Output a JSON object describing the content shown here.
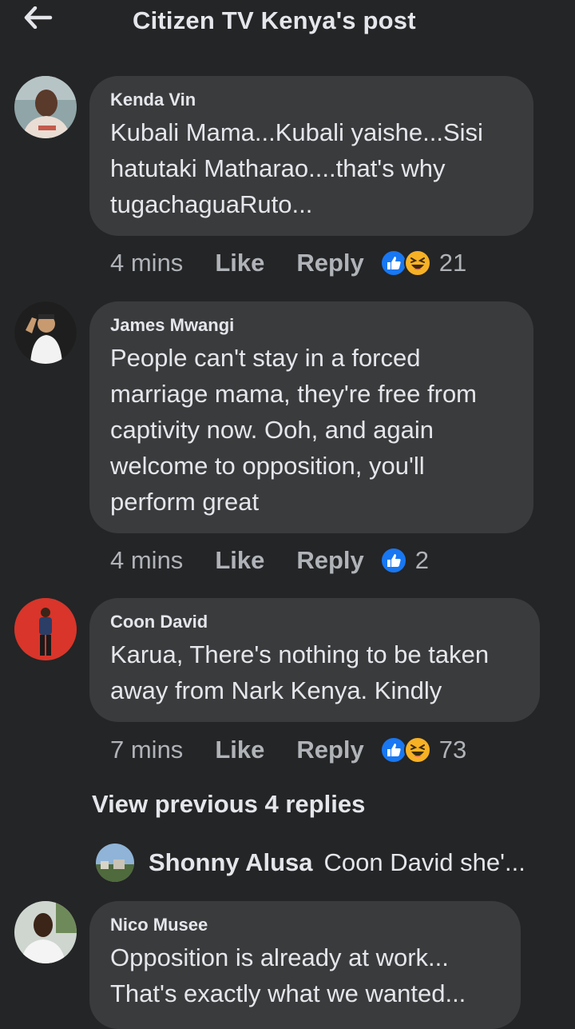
{
  "header": {
    "back_icon": "arrow-left-icon",
    "title": "Citizen TV Kenya's post"
  },
  "comments": [
    {
      "name": "Kenda Vin",
      "lines": [
        "Kubali Mama...Kubali yaishe...Sisi",
        "hatutaki Matharao....that's why",
        "tugachaguaRuto..."
      ],
      "time": "4 mins",
      "like": "Like",
      "reply": "Reply",
      "reactions": [
        "like-reaction-icon",
        "haha-reaction-icon"
      ],
      "count": "21"
    },
    {
      "name": "James Mwangi",
      "lines": [
        "People can't stay in a forced",
        "marriage mama, they're free from",
        "captivity now. Ooh, and again",
        "welcome to opposition, you'll",
        "perform great"
      ],
      "time": "4 mins",
      "like": "Like",
      "reply": "Reply",
      "reactions": [
        "like-reaction-icon"
      ],
      "count": "2"
    },
    {
      "name": "Coon David",
      "lines": [
        "Karua, There's nothing to be taken",
        "away from Nark Kenya. Kindly"
      ],
      "time": "7 mins",
      "like": "Like",
      "reply": "Reply",
      "reactions": [
        "like-reaction-icon",
        "haha-reaction-icon"
      ],
      "count": "73"
    },
    {
      "name": "Nico Musee",
      "lines": [
        "Opposition is already at work...",
        "That's exactly what we wanted..."
      ]
    }
  ],
  "view_previous": "View previous 4 replies",
  "reply_preview": {
    "name": "Shonny Alusa",
    "text": "Coon David she'..."
  },
  "colors": {
    "background": "#242526",
    "bubble": "#3a3b3c",
    "text": "#e4e6eb",
    "secondary_text": "#b0b3b8",
    "like_blue": "#1877f2",
    "haha_yellow": "#f7b125"
  }
}
